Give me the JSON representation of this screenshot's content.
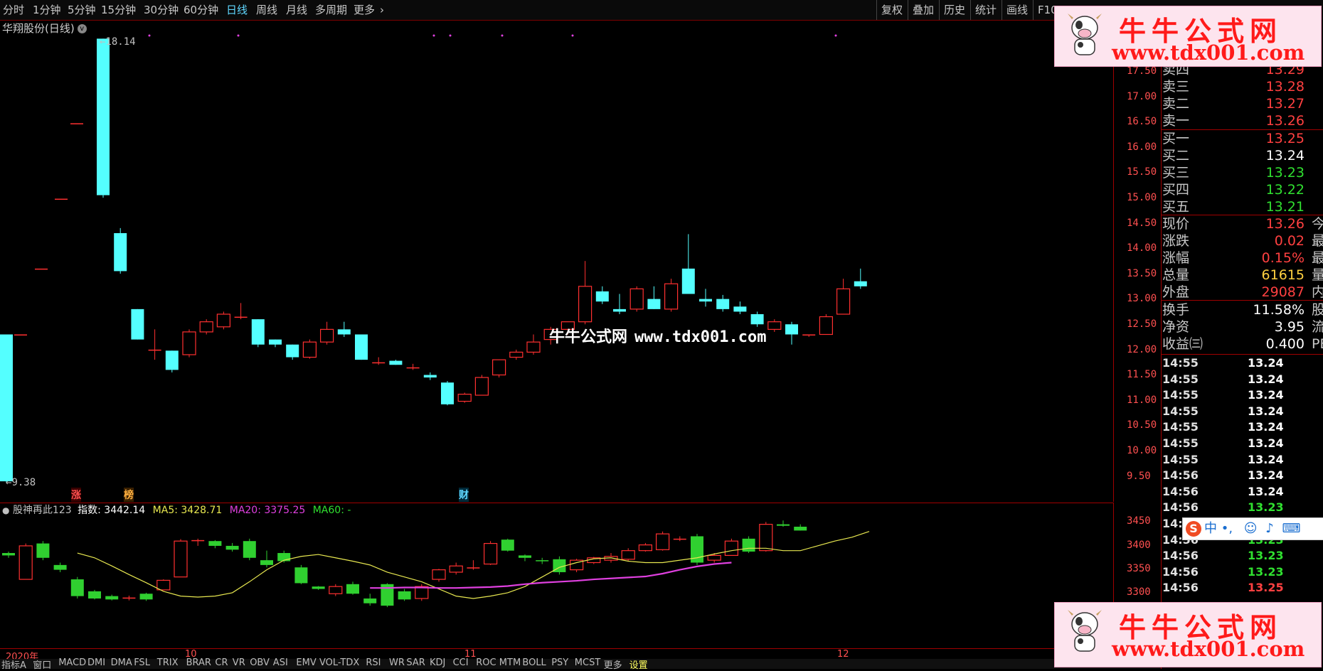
{
  "periods": [
    "分时",
    "1分钟",
    "5分钟",
    "15分钟",
    "30分钟",
    "60分钟",
    "日线",
    "周线",
    "月线",
    "多周期",
    "更多"
  ],
  "active_period": "日线",
  "tools": [
    "复权",
    "叠加",
    "历史",
    "统计",
    "画线",
    "F10"
  ],
  "stock_title": "华翔股份(日线)",
  "main_axis": [
    "17.50",
    "17.00",
    "16.50",
    "16.00",
    "15.50",
    "15.00",
    "14.50",
    "14.00",
    "13.50",
    "13.00",
    "12.50",
    "12.00",
    "11.50",
    "11.00",
    "10.50",
    "10.00",
    "9.50"
  ],
  "max_label": "18.14",
  "min_label": "9.38",
  "tags": {
    "zhang": "涨",
    "bang": "榜",
    "cai": "财"
  },
  "legend": {
    "name": "股神再此123",
    "index_label": "指数:",
    "index_value": "3442.14",
    "ma5": "MA5: 3428.71",
    "ma20": "MA20: 3375.25",
    "ma60": "MA60: -"
  },
  "sub_axis": [
    "3450",
    "3400",
    "3350",
    "3300"
  ],
  "dates": [
    "2020年",
    "10",
    "11",
    "12"
  ],
  "bottom_tabs": [
    "指标A",
    "窗口",
    "MACD",
    "DMI",
    "DMA",
    "FSL",
    "TRIX",
    "BRAR",
    "CR",
    "VR",
    "OBV",
    "ASI",
    "EMV",
    "VOL-TDX",
    "RSI",
    "WR",
    "SAR",
    "KDJ",
    "CCI",
    "ROC",
    "MTM",
    "BOLL",
    "PSY",
    "MCST",
    "更多",
    "设置"
  ],
  "bottom_active_tab": "设置",
  "quotes_sell": [
    {
      "label": "卖四",
      "value": "13.29",
      "color": "#ff4040"
    },
    {
      "label": "卖三",
      "value": "13.28",
      "color": "#ff4040"
    },
    {
      "label": "卖二",
      "value": "13.27",
      "color": "#ff4040"
    },
    {
      "label": "卖一",
      "value": "13.26",
      "color": "#ff4040"
    }
  ],
  "quotes_buy": [
    {
      "label": "买一",
      "value": "13.25",
      "color": "#ff4040"
    },
    {
      "label": "买二",
      "value": "13.24",
      "color": "#ffffff"
    },
    {
      "label": "买三",
      "value": "13.23",
      "color": "#30e030"
    },
    {
      "label": "买四",
      "value": "13.22",
      "color": "#30e030"
    },
    {
      "label": "买五",
      "value": "13.21",
      "color": "#30e030"
    }
  ],
  "quotes_info": [
    {
      "label": "现价",
      "value": "13.26",
      "color": "#ff4040",
      "sub": "今开"
    },
    {
      "label": "涨跌",
      "value": "0.02",
      "color": "#ff4040",
      "sub": "最高"
    },
    {
      "label": "涨幅",
      "value": "0.15%",
      "color": "#ff4040",
      "sub": "最低"
    },
    {
      "label": "总量",
      "value": "61615",
      "color": "#ffd040",
      "sub": "量比"
    },
    {
      "label": "外盘",
      "value": "29087",
      "color": "#ff4040",
      "sub": "内盘"
    }
  ],
  "quotes_info2": [
    {
      "label": "换手",
      "value": "11.58%",
      "color": "#ffffff",
      "sub": "股本"
    },
    {
      "label": "净资",
      "value": "3.95",
      "color": "#ffffff",
      "sub": "流通"
    },
    {
      "label": "收益㈢",
      "value": "0.400",
      "color": "#ffffff",
      "sub": "PE(动)"
    }
  ],
  "ticks": [
    {
      "time": "14:55",
      "price": "13.24",
      "color": "#ffffff"
    },
    {
      "time": "14:55",
      "price": "13.24",
      "color": "#ffffff"
    },
    {
      "time": "14:55",
      "price": "13.24",
      "color": "#ffffff"
    },
    {
      "time": "14:55",
      "price": "13.24",
      "color": "#ffffff"
    },
    {
      "time": "14:55",
      "price": "13.24",
      "color": "#ffffff"
    },
    {
      "time": "14:55",
      "price": "13.24",
      "color": "#ffffff"
    },
    {
      "time": "14:55",
      "price": "13.24",
      "color": "#ffffff"
    },
    {
      "time": "14:56",
      "price": "13.24",
      "color": "#ffffff"
    },
    {
      "time": "14:56",
      "price": "13.24",
      "color": "#ffffff"
    },
    {
      "time": "14:56",
      "price": "13.23",
      "color": "#30e030"
    },
    {
      "time": "14:56",
      "price": "13.23",
      "color": "#30e030"
    },
    {
      "time": "14:56",
      "price": "13.23",
      "color": "#30e030"
    },
    {
      "time": "14:56",
      "price": "13.23",
      "color": "#30e030"
    },
    {
      "time": "14:56",
      "price": "13.23",
      "color": "#30e030"
    },
    {
      "time": "14:56",
      "price": "13.25",
      "color": "#ff4040"
    }
  ],
  "watermark": {
    "title": "牛牛公式网",
    "url": "www.tdx001.com"
  },
  "center_watermark": {
    "title": "牛牛公式网",
    "url": "www.tdx001.com"
  },
  "ime": {
    "logo": "S",
    "text": "中 •,"
  },
  "colors": {
    "up": "#ff3030",
    "down": "#54ffff",
    "vol_down": "#30d030",
    "ma5": "#e8e850",
    "ma20": "#e040e0"
  },
  "chart_data": {
    "type": "candlestick",
    "ylim": [
      9.38,
      18.14
    ],
    "candles": [
      {
        "o": 12.3,
        "h": 12.3,
        "l": 9.38,
        "c": 9.4
      },
      {
        "o": 12.3,
        "h": 12.3,
        "l": 12.3,
        "c": 12.3
      },
      {
        "o": 13.6,
        "h": 13.6,
        "l": 13.6,
        "c": 13.6
      },
      {
        "o": 14.98,
        "h": 14.98,
        "l": 14.98,
        "c": 14.98
      },
      {
        "o": 16.47,
        "h": 16.47,
        "l": 16.47,
        "c": 16.47
      },
      {
        "o": 18.14,
        "h": 18.14,
        "l": 15.0,
        "c": 15.05
      },
      {
        "o": 14.3,
        "h": 14.4,
        "l": 13.5,
        "c": 13.55
      },
      {
        "o": 12.8,
        "h": 12.8,
        "l": 12.2,
        "c": 12.2
      },
      {
        "o": 12.0,
        "h": 12.4,
        "l": 11.8,
        "c": 12.0
      },
      {
        "o": 11.98,
        "h": 11.98,
        "l": 11.55,
        "c": 11.6
      },
      {
        "o": 11.9,
        "h": 12.4,
        "l": 11.85,
        "c": 12.35
      },
      {
        "o": 12.35,
        "h": 12.6,
        "l": 12.3,
        "c": 12.55
      },
      {
        "o": 12.45,
        "h": 12.75,
        "l": 12.4,
        "c": 12.7
      },
      {
        "o": 12.65,
        "h": 12.92,
        "l": 12.6,
        "c": 12.65
      },
      {
        "o": 12.6,
        "h": 12.6,
        "l": 12.05,
        "c": 12.1
      },
      {
        "o": 12.2,
        "h": 12.2,
        "l": 12.05,
        "c": 12.1
      },
      {
        "o": 12.1,
        "h": 12.1,
        "l": 11.8,
        "c": 11.85
      },
      {
        "o": 11.85,
        "h": 12.2,
        "l": 11.82,
        "c": 12.15
      },
      {
        "o": 12.15,
        "h": 12.55,
        "l": 12.1,
        "c": 12.4
      },
      {
        "o": 12.4,
        "h": 12.55,
        "l": 12.25,
        "c": 12.3
      },
      {
        "o": 12.3,
        "h": 12.3,
        "l": 11.8,
        "c": 11.8
      },
      {
        "o": 11.75,
        "h": 11.85,
        "l": 11.7,
        "c": 11.75
      },
      {
        "o": 11.78,
        "h": 11.8,
        "l": 11.7,
        "c": 11.7
      },
      {
        "o": 11.65,
        "h": 11.72,
        "l": 11.6,
        "c": 11.65
      },
      {
        "o": 11.5,
        "h": 11.55,
        "l": 11.4,
        "c": 11.45
      },
      {
        "o": 11.35,
        "h": 11.38,
        "l": 10.9,
        "c": 10.92
      },
      {
        "o": 10.98,
        "h": 11.15,
        "l": 10.95,
        "c": 11.12
      },
      {
        "o": 11.1,
        "h": 11.5,
        "l": 11.1,
        "c": 11.45
      },
      {
        "o": 11.5,
        "h": 11.8,
        "l": 11.45,
        "c": 11.8
      },
      {
        "o": 11.85,
        "h": 12.0,
        "l": 11.8,
        "c": 11.95
      },
      {
        "o": 11.95,
        "h": 12.3,
        "l": 11.9,
        "c": 12.15
      },
      {
        "o": 12.2,
        "h": 12.45,
        "l": 12.1,
        "c": 12.4
      },
      {
        "o": 12.4,
        "h": 12.55,
        "l": 12.3,
        "c": 12.55
      },
      {
        "o": 12.55,
        "h": 13.75,
        "l": 12.5,
        "c": 13.25
      },
      {
        "o": 13.15,
        "h": 13.25,
        "l": 12.9,
        "c": 12.95
      },
      {
        "o": 12.8,
        "h": 13.1,
        "l": 12.7,
        "c": 12.75
      },
      {
        "o": 12.8,
        "h": 13.25,
        "l": 12.75,
        "c": 13.2
      },
      {
        "o": 13.0,
        "h": 13.25,
        "l": 12.8,
        "c": 12.8
      },
      {
        "o": 12.8,
        "h": 13.4,
        "l": 12.75,
        "c": 13.3
      },
      {
        "o": 13.6,
        "h": 14.28,
        "l": 13.1,
        "c": 13.1
      },
      {
        "o": 13.0,
        "h": 13.2,
        "l": 12.85,
        "c": 12.95
      },
      {
        "o": 13.0,
        "h": 13.08,
        "l": 12.75,
        "c": 12.8
      },
      {
        "o": 12.85,
        "h": 12.95,
        "l": 12.7,
        "c": 12.75
      },
      {
        "o": 12.7,
        "h": 12.75,
        "l": 12.45,
        "c": 12.5
      },
      {
        "o": 12.4,
        "h": 12.6,
        "l": 12.35,
        "c": 12.55
      },
      {
        "o": 12.5,
        "h": 12.55,
        "l": 12.1,
        "c": 12.3
      },
      {
        "o": 12.3,
        "h": 12.3,
        "l": 12.25,
        "c": 12.3
      },
      {
        "o": 12.3,
        "h": 12.7,
        "l": 12.3,
        "c": 12.65
      },
      {
        "o": 12.7,
        "h": 13.4,
        "l": 12.7,
        "c": 13.2
      },
      {
        "o": 13.35,
        "h": 13.6,
        "l": 13.2,
        "c": 13.25
      }
    ],
    "sub_ylim": [
      3260,
      3475
    ],
    "sub_candles": [
      {
        "o": 3395,
        "h": 3398,
        "l": 3385,
        "c": 3390
      },
      {
        "o": 3340,
        "h": 3415,
        "l": 3340,
        "c": 3410
      },
      {
        "o": 3415,
        "h": 3420,
        "l": 3380,
        "c": 3385
      },
      {
        "o": 3370,
        "h": 3375,
        "l": 3355,
        "c": 3360
      },
      {
        "o": 3340,
        "h": 3345,
        "l": 3300,
        "c": 3305
      },
      {
        "o": 3315,
        "h": 3318,
        "l": 3298,
        "c": 3300
      },
      {
        "o": 3305,
        "h": 3308,
        "l": 3296,
        "c": 3298
      },
      {
        "o": 3302,
        "h": 3306,
        "l": 3296,
        "c": 3302
      },
      {
        "o": 3310,
        "h": 3312,
        "l": 3295,
        "c": 3298
      },
      {
        "o": 3318,
        "h": 3340,
        "l": 3317,
        "c": 3338
      },
      {
        "o": 3345,
        "h": 3424,
        "l": 3345,
        "c": 3420
      },
      {
        "o": 3422,
        "h": 3425,
        "l": 3410,
        "c": 3422
      },
      {
        "o": 3420,
        "h": 3422,
        "l": 3405,
        "c": 3410
      },
      {
        "o": 3410,
        "h": 3416,
        "l": 3398,
        "c": 3402
      },
      {
        "o": 3420,
        "h": 3425,
        "l": 3380,
        "c": 3385
      },
      {
        "o": 3380,
        "h": 3400,
        "l": 3365,
        "c": 3370
      },
      {
        "o": 3395,
        "h": 3400,
        "l": 3375,
        "c": 3378
      },
      {
        "o": 3365,
        "h": 3370,
        "l": 3330,
        "c": 3332
      },
      {
        "o": 3325,
        "h": 3326,
        "l": 3318,
        "c": 3320
      },
      {
        "o": 3310,
        "h": 3330,
        "l": 3305,
        "c": 3325
      },
      {
        "o": 3330,
        "h": 3335,
        "l": 3308,
        "c": 3310
      },
      {
        "o": 3300,
        "h": 3310,
        "l": 3285,
        "c": 3290
      },
      {
        "o": 3330,
        "h": 3332,
        "l": 3282,
        "c": 3285
      },
      {
        "o": 3315,
        "h": 3320,
        "l": 3295,
        "c": 3298
      },
      {
        "o": 3300,
        "h": 3330,
        "l": 3295,
        "c": 3325
      },
      {
        "o": 3340,
        "h": 3362,
        "l": 3335,
        "c": 3360
      },
      {
        "o": 3355,
        "h": 3375,
        "l": 3350,
        "c": 3368
      },
      {
        "o": 3365,
        "h": 3380,
        "l": 3360,
        "c": 3365
      },
      {
        "o": 3372,
        "h": 3420,
        "l": 3370,
        "c": 3415
      },
      {
        "o": 3423,
        "h": 3425,
        "l": 3398,
        "c": 3400
      },
      {
        "o": 3390,
        "h": 3392,
        "l": 3378,
        "c": 3385
      },
      {
        "o": 3380,
        "h": 3385,
        "l": 3372,
        "c": 3378
      },
      {
        "o": 3382,
        "h": 3388,
        "l": 3350,
        "c": 3355
      },
      {
        "o": 3360,
        "h": 3383,
        "l": 3355,
        "c": 3380
      },
      {
        "o": 3375,
        "h": 3387,
        "l": 3372,
        "c": 3385
      },
      {
        "o": 3380,
        "h": 3395,
        "l": 3375,
        "c": 3388
      },
      {
        "o": 3382,
        "h": 3405,
        "l": 3378,
        "c": 3400
      },
      {
        "o": 3400,
        "h": 3416,
        "l": 3398,
        "c": 3412
      },
      {
        "o": 3402,
        "h": 3440,
        "l": 3400,
        "c": 3435
      },
      {
        "o": 3425,
        "h": 3430,
        "l": 3420,
        "c": 3425
      },
      {
        "o": 3430,
        "h": 3435,
        "l": 3370,
        "c": 3375
      },
      {
        "o": 3380,
        "h": 3395,
        "l": 3375,
        "c": 3390
      },
      {
        "o": 3390,
        "h": 3425,
        "l": 3390,
        "c": 3420
      },
      {
        "o": 3425,
        "h": 3430,
        "l": 3395,
        "c": 3398
      },
      {
        "o": 3400,
        "h": 3460,
        "l": 3398,
        "c": 3455
      },
      {
        "o": 3455,
        "h": 3463,
        "l": 3450,
        "c": 3452
      },
      {
        "o": 3450,
        "h": 3455,
        "l": 3442,
        "c": 3442
      }
    ],
    "ma5": [
      3395,
      3385,
      3368,
      3350,
      3333,
      3315,
      3305,
      3303,
      3305,
      3312,
      3335,
      3360,
      3380,
      3388,
      3392,
      3385,
      3378,
      3370,
      3355,
      3345,
      3335,
      3320,
      3305,
      3300,
      3305,
      3312,
      3325,
      3345,
      3365,
      3375,
      3383,
      3385,
      3378,
      3375,
      3375,
      3380,
      3385,
      3393,
      3400,
      3405,
      3405,
      3400,
      3400,
      3410,
      3420,
      3428,
      3440
    ],
    "ma20": [
      3322,
      3322,
      3323,
      3323,
      3322,
      3322,
      3323,
      3324,
      3326,
      3330,
      3333,
      3335,
      3337,
      3340,
      3342,
      3344,
      3346,
      3352,
      3360,
      3367,
      3372,
      3375
    ]
  }
}
